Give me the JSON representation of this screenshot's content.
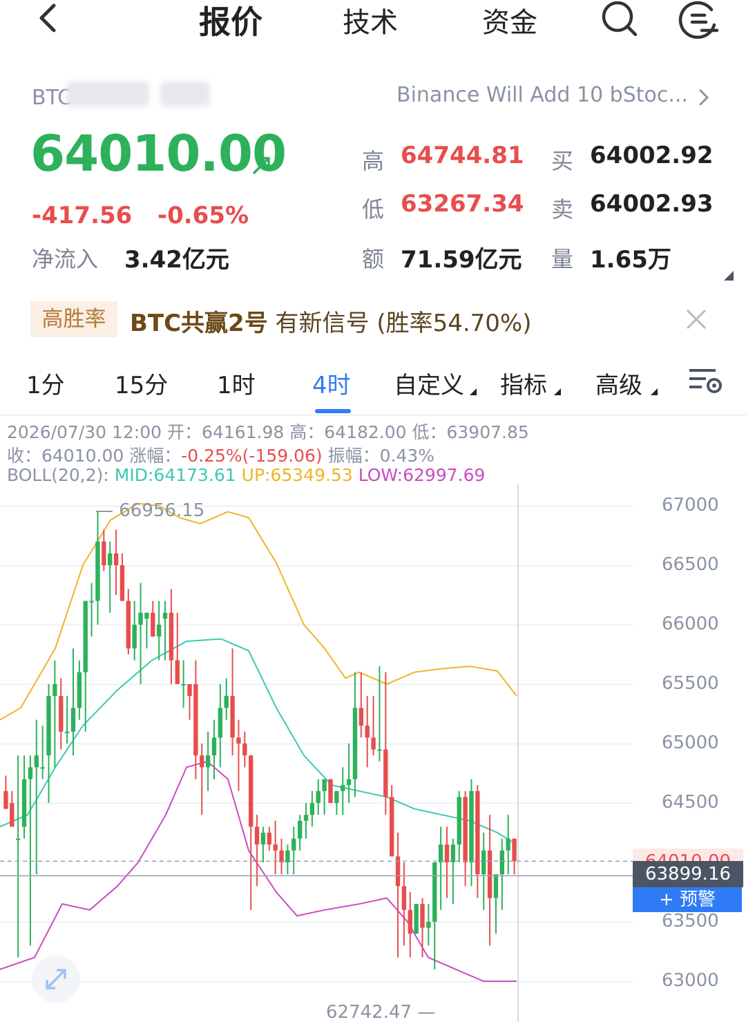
{
  "header": {
    "tabs": [
      {
        "label": "报价",
        "active": true
      },
      {
        "label": "技术",
        "active": false
      },
      {
        "label": "资金",
        "active": false
      }
    ]
  },
  "quote": {
    "ticker_prefix": "BTC",
    "news": "Binance Will Add 10 bStoc...",
    "price": "64010.00",
    "change": "-417.56",
    "change_pct": "-0.65%",
    "netflow_label": "净流入",
    "netflow_value": "3.42亿元",
    "high_label": "高",
    "high_value": "64744.81",
    "low_label": "低",
    "low_value": "63267.34",
    "amount_label": "额",
    "amount_value": "71.59亿元",
    "bid_label": "买",
    "bid_value": "64002.92",
    "ask_label": "卖",
    "ask_value": "64002.93",
    "volume_label": "量",
    "volume_value": "1.65万"
  },
  "signal": {
    "badge": "高胜率",
    "name": "BTC共赢2号",
    "text": " 有新信号 (胜率54.70%)"
  },
  "periods": [
    {
      "label": "1分"
    },
    {
      "label": "15分"
    },
    {
      "label": "1时"
    },
    {
      "label": "4时",
      "active": true
    },
    {
      "label": "自定义",
      "dropdown": true
    },
    {
      "label": "指标",
      "dropdown": true
    },
    {
      "label": "高级",
      "dropdown": true
    }
  ],
  "ohlc_info": {
    "line1": "2026/07/30 12:00 开：64161.98 高：64182.00 低：63907.85",
    "close": "收：64010.00 涨幅：",
    "change": "-0.25%(-159.06)",
    "amplitude": " 振幅：0.43%",
    "boll_label": "BOLL(20,2): ",
    "boll_mid": "MID:64173.61",
    "boll_up": "UP:65349.53",
    "boll_low": "LOW:62997.69"
  },
  "chart_labels": {
    "max": "66956.15",
    "min": "62742.47",
    "last_price": "64010.00",
    "crosshair_price": "63899.16",
    "alert_button": "+ 预警"
  },
  "colors": {
    "up": "#2db15b",
    "down": "#e84d4d",
    "mid": "#3cc8b4",
    "upper": "#f0b429",
    "lower": "#c84cc0",
    "accent": "#2f7bf6"
  },
  "chart_data": {
    "type": "candlestick",
    "y_ticks": [
      67000,
      66500,
      66000,
      65500,
      65000,
      64500,
      63500,
      63000
    ],
    "ylim": [
      62650,
      67100
    ],
    "candles": [
      [
        64600,
        64730,
        64480,
        64450
      ],
      [
        64500,
        64600,
        64300,
        64300
      ],
      [
        64200,
        64900,
        63200,
        64200
      ],
      [
        64300,
        64900,
        64200,
        64700
      ],
      [
        64700,
        64900,
        63300,
        64800
      ],
      [
        64800,
        65200,
        63900,
        64900
      ],
      [
        64800,
        65150,
        64700,
        64800
      ],
      [
        64900,
        65500,
        64500,
        65400
      ],
      [
        65400,
        65700,
        64800,
        65500
      ],
      [
        65400,
        65550,
        64950,
        65100
      ],
      [
        65100,
        65400,
        65000,
        65100
      ],
      [
        65100,
        65800,
        64900,
        65300
      ],
      [
        65300,
        65700,
        65200,
        65600
      ],
      [
        65600,
        66200,
        65100,
        66200
      ],
      [
        66200,
        66350,
        65900,
        66200
      ],
      [
        66200,
        66950,
        66000,
        66700
      ],
      [
        66700,
        66800,
        66450,
        66500
      ],
      [
        66500,
        66700,
        66100,
        66600
      ],
      [
        66600,
        66800,
        66250,
        66500
      ],
      [
        66500,
        66600,
        66200,
        66200
      ],
      [
        66200,
        66300,
        65750,
        65800
      ],
      [
        65800,
        66200,
        65700,
        66000
      ],
      [
        66000,
        66350,
        65500,
        66100
      ],
      [
        66050,
        66100,
        65800,
        66100
      ],
      [
        66100,
        66200,
        65900,
        65900
      ],
      [
        65900,
        66200,
        65700,
        66000
      ],
      [
        66050,
        66200,
        65700,
        66100
      ],
      [
        66100,
        66300,
        65500,
        65700
      ],
      [
        65700,
        66100,
        65500,
        65500
      ],
      [
        65500,
        65700,
        65300,
        65500
      ],
      [
        65500,
        65500,
        65200,
        65400
      ],
      [
        65500,
        65700,
        64700,
        64900
      ],
      [
        64900,
        65000,
        64400,
        64800
      ],
      [
        64800,
        65100,
        64600,
        64900
      ],
      [
        64900,
        65200,
        64700,
        65050
      ],
      [
        65050,
        65500,
        64800,
        65300
      ],
      [
        65300,
        65550,
        65200,
        65400
      ],
      [
        65400,
        65800,
        64900,
        65050
      ],
      [
        65050,
        65200,
        64600,
        65000
      ],
      [
        65000,
        65100,
        64800,
        64900
      ],
      [
        64900,
        64900,
        63600,
        64300
      ],
      [
        64300,
        64400,
        63800,
        64150
      ],
      [
        64150,
        64300,
        64000,
        64250
      ],
      [
        64250,
        64300,
        64100,
        64150
      ],
      [
        64150,
        64350,
        63900,
        64100
      ],
      [
        64100,
        64200,
        63900,
        64000
      ],
      [
        64000,
        64150,
        63900,
        64100
      ],
      [
        64100,
        64300,
        63900,
        64200
      ],
      [
        64200,
        64400,
        64100,
        64350
      ],
      [
        64350,
        64500,
        64200,
        64400
      ],
      [
        64400,
        64600,
        64300,
        64500
      ],
      [
        64500,
        64700,
        64400,
        64600
      ],
      [
        64600,
        64700,
        64400,
        64700
      ],
      [
        64700,
        64700,
        64500,
        64500
      ],
      [
        64500,
        64600,
        64400,
        64600
      ],
      [
        64600,
        64800,
        64400,
        64650
      ],
      [
        64650,
        65000,
        64500,
        64700
      ],
      [
        64700,
        65600,
        64550,
        65300
      ],
      [
        65300,
        65600,
        65050,
        65150
      ],
      [
        65150,
        65400,
        64800,
        65050
      ],
      [
        65050,
        65400,
        64900,
        64950
      ],
      [
        64950,
        65650,
        64850,
        64950
      ],
      [
        64950,
        65600,
        64400,
        64550
      ],
      [
        64550,
        64650,
        64100,
        64050
      ],
      [
        64050,
        64250,
        63200,
        63800
      ],
      [
        63800,
        64000,
        63300,
        63600
      ],
      [
        63600,
        63750,
        63200,
        63400
      ],
      [
        63400,
        63650,
        63400,
        63650
      ],
      [
        63650,
        63700,
        63200,
        63450
      ],
      [
        63450,
        63650,
        63300,
        63500
      ],
      [
        63500,
        63800,
        63100,
        64000
      ],
      [
        64000,
        64300,
        63600,
        64150
      ],
      [
        64150,
        64300,
        63700,
        64000
      ],
      [
        64000,
        64200,
        63650,
        64150
      ],
      [
        64150,
        64600,
        64000,
        64550
      ],
      [
        64550,
        64600,
        63800,
        64000
      ],
      [
        64000,
        64700,
        63800,
        64600
      ],
      [
        64600,
        64650,
        63700,
        63900
      ],
      [
        63900,
        64250,
        63600,
        64100
      ],
      [
        64100,
        64400,
        63300,
        63700
      ],
      [
        63700,
        63900,
        63400,
        63900
      ],
      [
        63900,
        64200,
        63600,
        64100
      ],
      [
        64100,
        64400,
        63900,
        64200
      ],
      [
        64200,
        64200,
        63900,
        64010
      ]
    ],
    "boll_upper": [
      [
        0,
        65200
      ],
      [
        30,
        65300
      ],
      [
        80,
        65800
      ],
      [
        120,
        66500
      ],
      [
        160,
        66880
      ],
      [
        200,
        67020
      ],
      [
        230,
        67000
      ],
      [
        260,
        66900
      ],
      [
        290,
        66850
      ],
      [
        330,
        66950
      ],
      [
        360,
        66900
      ],
      [
        400,
        66520
      ],
      [
        440,
        66000
      ],
      [
        470,
        65800
      ],
      [
        500,
        65550
      ],
      [
        520,
        65600
      ],
      [
        540,
        65550
      ],
      [
        560,
        65500
      ],
      [
        600,
        65600
      ],
      [
        640,
        65630
      ],
      [
        680,
        65650
      ],
      [
        720,
        65610
      ],
      [
        748,
        65400
      ]
    ],
    "boll_mid": [
      [
        0,
        64300
      ],
      [
        40,
        64400
      ],
      [
        80,
        64800
      ],
      [
        120,
        65150
      ],
      [
        170,
        65450
      ],
      [
        220,
        65700
      ],
      [
        270,
        65860
      ],
      [
        320,
        65880
      ],
      [
        360,
        65780
      ],
      [
        400,
        65300
      ],
      [
        440,
        64900
      ],
      [
        480,
        64650
      ],
      [
        520,
        64600
      ],
      [
        560,
        64550
      ],
      [
        600,
        64450
      ],
      [
        640,
        64400
      ],
      [
        680,
        64350
      ],
      [
        720,
        64250
      ],
      [
        748,
        64150
      ]
    ],
    "boll_lower": [
      [
        0,
        63100
      ],
      [
        50,
        63200
      ],
      [
        90,
        63650
      ],
      [
        130,
        63600
      ],
      [
        170,
        63800
      ],
      [
        200,
        64000
      ],
      [
        240,
        64400
      ],
      [
        270,
        64800
      ],
      [
        300,
        64850
      ],
      [
        330,
        64700
      ],
      [
        360,
        64100
      ],
      [
        400,
        63750
      ],
      [
        430,
        63550
      ],
      [
        470,
        63600
      ],
      [
        520,
        63650
      ],
      [
        560,
        63700
      ],
      [
        590,
        63500
      ],
      [
        620,
        63200
      ],
      [
        660,
        63100
      ],
      [
        700,
        63000
      ],
      [
        748,
        63000
      ]
    ]
  }
}
